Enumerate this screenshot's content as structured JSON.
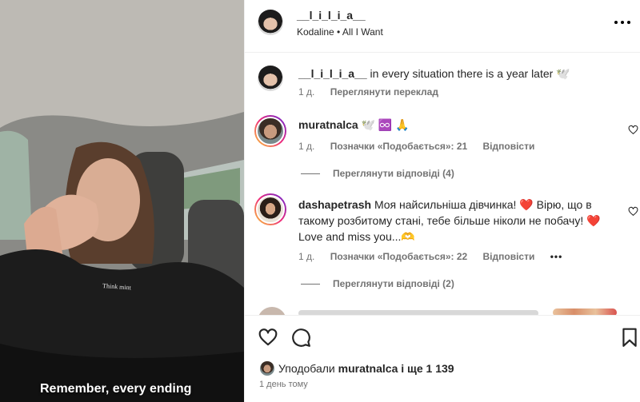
{
  "media": {
    "caption": "Remember, every ending",
    "shirt_text": "Think mint"
  },
  "header": {
    "username": "__l_i_l_i_a__",
    "song": "Kodaline • All I Want"
  },
  "caption_comment": {
    "username": "__l_i_l_i_a__",
    "text": "in every situation there is a year later 🕊️",
    "time": "1 д.",
    "translate": "Переглянути переклад"
  },
  "comments": [
    {
      "username": "muratnalca",
      "text": "🕊️ ♾️ 🙏",
      "time": "1 д.",
      "likes": "Позначки «Подобається»: 21",
      "reply": "Відповісти",
      "view_replies": "Переглянути відповіді (4)"
    },
    {
      "username": "dashapetrash",
      "text": "Моя найсильніша дівчинка! ❤️ Вірю, що в такому розбитому стані, тебе більше ніколи не побачу! ❤️ Love and miss you...🫶",
      "time": "1 д.",
      "likes": "Позначки «Подобається»: 22",
      "reply": "Відповісти",
      "more": "•••",
      "view_replies": "Переглянути відповіді (2)"
    }
  ],
  "footer": {
    "liked_prefix": "Уподобали",
    "liked_user": "muratnalca",
    "liked_suffix": "і ще 1 139",
    "date": "1 день тому"
  }
}
